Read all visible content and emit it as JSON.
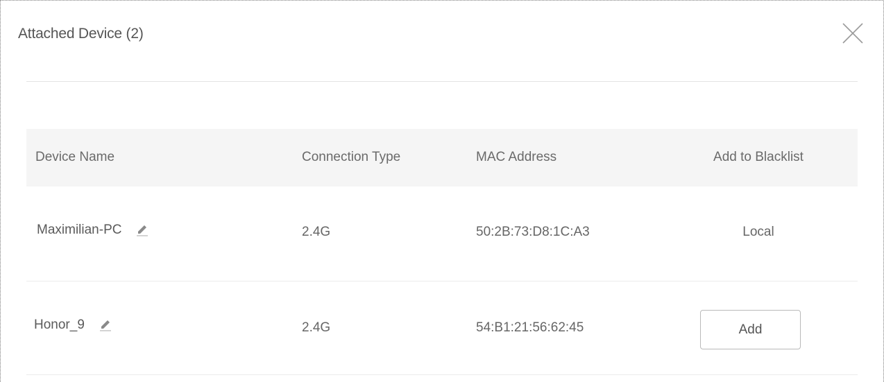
{
  "dialog": {
    "title": "Attached Device (2)",
    "close_icon": "close-icon"
  },
  "table": {
    "headers": {
      "device_name": "Device Name",
      "connection_type": "Connection Type",
      "mac_address": "MAC Address",
      "blacklist": "Add to Blacklist"
    },
    "rows": [
      {
        "device_name": "Maximilian-PC",
        "edit_icon": "pencil-icon",
        "connection_type": "2.4G",
        "mac_address": "50:2B:73:D8:1C:A3",
        "blacklist_text": "Local"
      },
      {
        "device_name": "Honor_9",
        "edit_icon": "pencil-icon",
        "connection_type": "2.4G",
        "mac_address": "54:B1:21:56:62:45",
        "blacklist_button_label": "Add"
      }
    ]
  },
  "colors": {
    "text": "#555555",
    "header_background": "#f5f5f5",
    "divider": "#e3e3e3",
    "button_border": "#b9b9b9"
  }
}
